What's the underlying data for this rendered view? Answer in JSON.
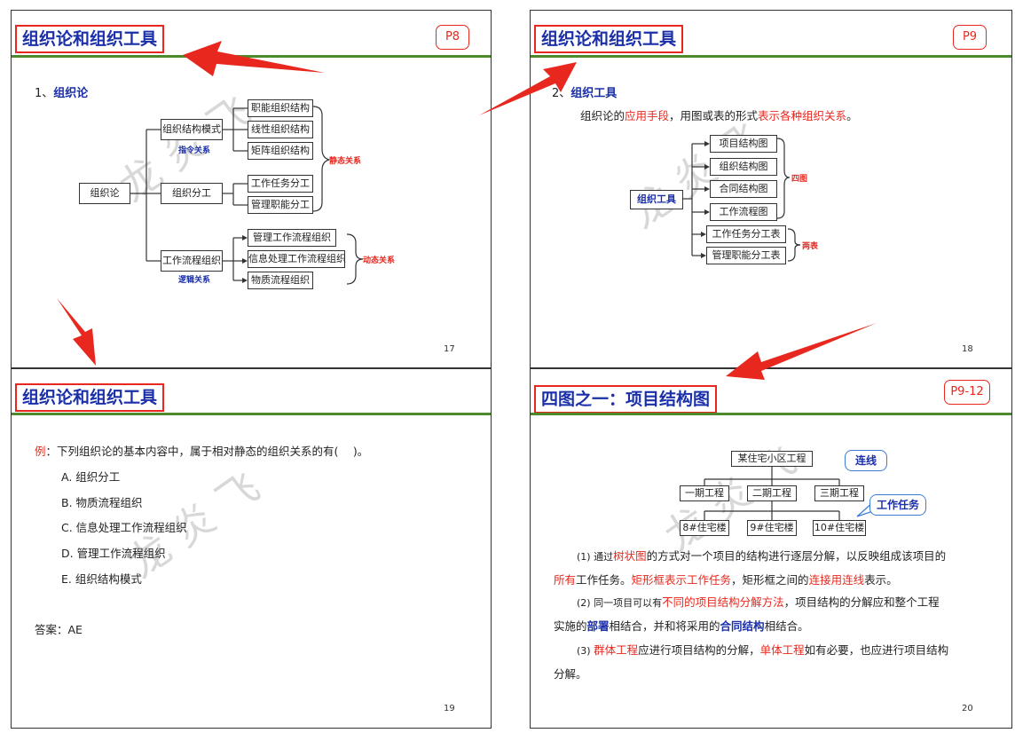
{
  "s17": {
    "title": "组织论和组织工具",
    "badge": "P8",
    "page": "17",
    "heading_num": "1、",
    "heading": "组织论",
    "root": "组织论",
    "level1": [
      "组织结构模式",
      "组织分工",
      "工作流程组织"
    ],
    "level1_notes": [
      "指令关系",
      "逻辑关系"
    ],
    "leaves_a": [
      "职能组织结构",
      "线性组织结构",
      "矩阵组织结构"
    ],
    "leaves_b": [
      "工作任务分工",
      "管理职能分工"
    ],
    "leaves_c": [
      "管理工作流程组织",
      "信息处理工作流程组织",
      "物质流程组织"
    ],
    "static_label": "静态关系",
    "dynamic_label": "动态关系",
    "watermark": "龙 炎 飞"
  },
  "s18": {
    "title": "组织论和组织工具",
    "badge": "P9",
    "page": "18",
    "heading_num": "2、",
    "heading": "组织工具",
    "line_prefix": "组织论的",
    "line_red1": "应用手段",
    "line_mid": "，用图或表的形式",
    "line_red2": "表示各种组织关系",
    "line_end": "。",
    "root": "组织工具",
    "items": [
      "项目结构图",
      "组织结构图",
      "合同结构图",
      "工作流程图",
      "工作任务分工表",
      "管理职能分工表"
    ],
    "group1": "四图",
    "group2": "两表",
    "watermark": "龙 炎 飞"
  },
  "s19": {
    "title": "组织论和组织工具",
    "page": "19",
    "q_prefix": "例",
    "question": "：下列组织论的基本内容中，属于相对静态的组织关系的有(　 )。",
    "options": [
      "A. 组织分工",
      "B. 物质流程组织",
      "C. 信息处理工作流程组织",
      "D. 管理工作流程组织",
      "E. 组织结构模式"
    ],
    "answer": "答案：AE",
    "watermark": "龙 炎 飞"
  },
  "s20": {
    "title": "四图之一：项目结构图",
    "badge": "P9-12",
    "page": "20",
    "top": "某住宅小区工程",
    "phases": [
      "一期工程",
      "二期工程",
      "三期工程"
    ],
    "buildings": [
      "8#住宅楼",
      "9#住宅楼",
      "10#住宅楼"
    ],
    "callout1": "连线",
    "callout2": "工作任务",
    "p1": {
      "a": "(1) 通过",
      "b": "树状图",
      "c": "的方式对一个项目的结构进行逐层分解，以反映组成该项目的",
      "d": "所有",
      "e": "工作任务。",
      "f": "矩形框表示工作任务",
      "g": "，矩形框之间的",
      "h": "连接用连线",
      "i": "表示。"
    },
    "p2": {
      "a": "(2) 同一项目可以有",
      "b": "不同的项目结构分解方法",
      "c": "，项目结构的分解应和整个工程",
      "d": "实施的",
      "e": "部署",
      "f": "相结合，并和将采用的",
      "g": "合同结构",
      "h": "相结合。"
    },
    "p3": {
      "a": "(3) ",
      "b": "群体工程",
      "c": "应进行项目结构的分解，",
      "d": "单体工程",
      "e": "如有必要，也应进行项目结构",
      "f": "分解。"
    },
    "watermark": "龙 炎 飞"
  },
  "colors": {
    "accent_red": "#e8281e",
    "title_blue": "#1a2fa8",
    "divider_green": "#4d8a2c"
  }
}
